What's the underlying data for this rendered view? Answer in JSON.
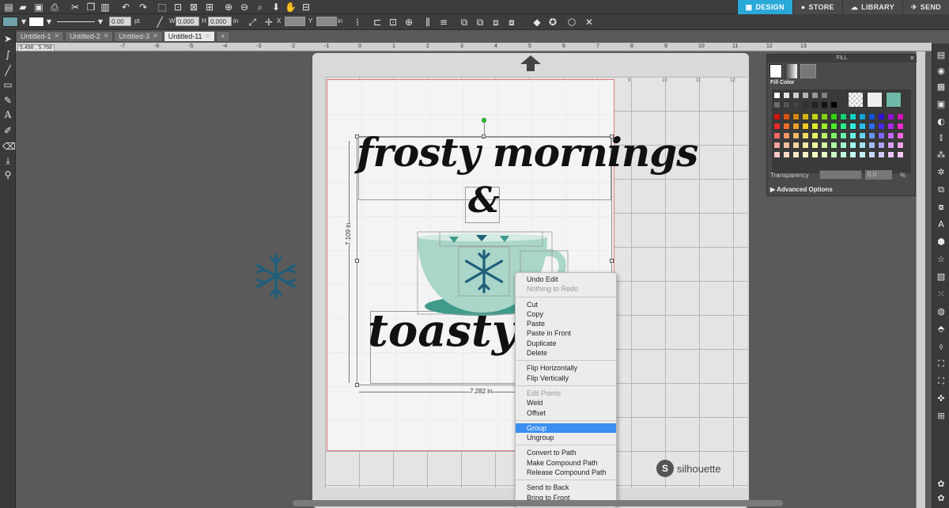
{
  "nav_tabs": [
    {
      "label": "DESIGN",
      "icon": "grid-icon",
      "active": true
    },
    {
      "label": "STORE",
      "icon": "silhouette-s-icon",
      "active": false
    },
    {
      "label": "LIBRARY",
      "icon": "cloud-icon",
      "active": false
    },
    {
      "label": "SEND",
      "icon": "send-icon",
      "active": false
    }
  ],
  "toolbar": {
    "line_width_value": "0.00",
    "line_width_unit": "pt",
    "w_label": "W",
    "w_value": "0.000",
    "h_label": "H",
    "h_value": "0.000",
    "in_unit": "in",
    "x_label": "X",
    "y_label": "Y"
  },
  "doc_tabs": [
    {
      "label": "Untitled-1",
      "active": false
    },
    {
      "label": "Untitled-2",
      "active": false
    },
    {
      "label": "Untitled-3",
      "active": false
    },
    {
      "label": "Untitled-11",
      "active": true
    }
  ],
  "coords": "5.498 , 5.768",
  "hruler_numbers": [
    "-7",
    "-6",
    "-5",
    "-4",
    "-3",
    "-2",
    "-1",
    "0",
    "1",
    "2",
    "3",
    "4",
    "5",
    "6",
    "7",
    "8",
    "9",
    "10",
    "11",
    "12",
    "13"
  ],
  "mat_ruler_numbers": [
    "9",
    "10",
    "11",
    "12"
  ],
  "design": {
    "line1": "frosty mornings",
    "ampersand": "&",
    "line2": "toasty m",
    "height_dim": "7.109 in",
    "width_dim": "7.282 in"
  },
  "fill_panel": {
    "title": "FILL",
    "fill_color_label": "Fill Color",
    "transparency_label": "Transparency",
    "transparency_value": "0.0",
    "percent": "%",
    "advanced_label": "Advanced Options"
  },
  "context_menu": {
    "groups": [
      [
        {
          "label": "Undo Edit",
          "disabled": false
        },
        {
          "label": "Nothing to Redo",
          "disabled": true
        }
      ],
      [
        {
          "label": "Cut",
          "disabled": false
        },
        {
          "label": "Copy",
          "disabled": false
        },
        {
          "label": "Paste",
          "disabled": false
        },
        {
          "label": "Paste in Front",
          "disabled": false
        },
        {
          "label": "Duplicate",
          "disabled": false
        },
        {
          "label": "Delete",
          "disabled": false
        }
      ],
      [
        {
          "label": "Flip Horizontally",
          "disabled": false
        },
        {
          "label": "Flip Vertically",
          "disabled": false
        }
      ],
      [
        {
          "label": "Edit Points",
          "disabled": true
        },
        {
          "label": "Weld",
          "disabled": false
        },
        {
          "label": "Offset",
          "disabled": false
        }
      ],
      [
        {
          "label": "Group",
          "disabled": false,
          "selected": true
        },
        {
          "label": "Ungroup",
          "disabled": false
        }
      ],
      [
        {
          "label": "Convert to Path",
          "disabled": false
        },
        {
          "label": "Make Compound Path",
          "disabled": false
        },
        {
          "label": "Release Compound Path",
          "disabled": false
        }
      ],
      [
        {
          "label": "Send to Back",
          "disabled": false
        },
        {
          "label": "Bring to Front",
          "disabled": false
        }
      ]
    ]
  },
  "watermark": "silhouette",
  "colors": {
    "accent": "#2aa9d8",
    "mug": "#a9d6c8",
    "mug_dark": "#3f9a8a",
    "snowflake": "#1e5f7a",
    "menu_highlight": "#3c8ff0"
  }
}
